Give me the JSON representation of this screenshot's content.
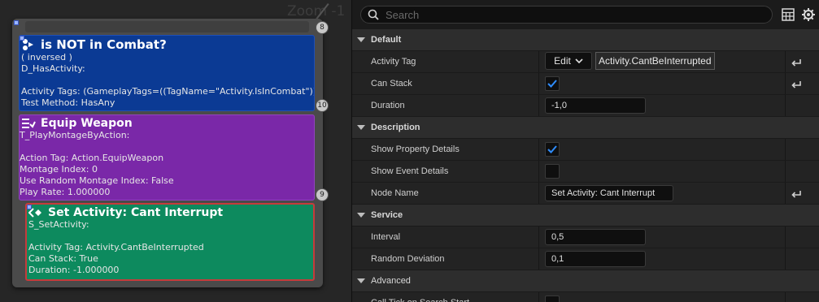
{
  "graph": {
    "zoom_label": "Zoom -1",
    "pins": {
      "top": "8",
      "combat_bottom": "10",
      "equip_bottom": "9"
    },
    "nodes": {
      "combat": {
        "title": "is NOT in Combat?",
        "lines": [
          "( inversed )",
          "D_HasActivity:",
          "",
          "Activity Tags: (GameplayTags=((TagName=\"Activity.IsInCombat\")))",
          "Test Method: HasAny"
        ],
        "color": "#0b3a94"
      },
      "equip": {
        "title": "Equip Weapon",
        "lines": [
          "T_PlayMontageByAction:",
          "",
          "Action Tag: Action.EquipWeapon",
          "Montage Index: 0",
          "Use Random Montage Index: False",
          "Play Rate: 1.000000"
        ],
        "color": "#7a28a8"
      },
      "setact": {
        "title": "Set Activity: Cant Interrupt",
        "lines": [
          "S_SetActivity:",
          "",
          "Activity Tag: Activity.CantBeInterrupted",
          "Can Stack: True",
          "Duration: -1.000000"
        ],
        "color": "#0d8a5e"
      }
    }
  },
  "panel": {
    "search": {
      "placeholder": "Search"
    },
    "categories": {
      "default": "Default",
      "description": "Description",
      "service": "Service",
      "advanced": "Advanced"
    },
    "props": {
      "activity_tag": {
        "name": "Activity Tag",
        "edit_label": "Edit",
        "value": "Activity.CantBeInterrupted"
      },
      "can_stack": {
        "name": "Can Stack",
        "checked": true
      },
      "duration": {
        "name": "Duration",
        "value": "-1,0"
      },
      "show_property_details": {
        "name": "Show Property Details",
        "checked": true
      },
      "show_event_details": {
        "name": "Show Event Details",
        "checked": false
      },
      "node_name": {
        "name": "Node Name",
        "value": "Set Activity: Cant Interrupt"
      },
      "interval": {
        "name": "Interval",
        "value": "0,5"
      },
      "random_deviation": {
        "name": "Random Deviation",
        "value": "0,1"
      },
      "call_tick": {
        "name": "Call Tick on Search Start",
        "checked": false
      }
    },
    "colors": {
      "accent": "#2f8dff",
      "panel_bg": "#1b1b1b",
      "row_bg": "#232323",
      "category_bg": "#2d2d2d"
    }
  }
}
